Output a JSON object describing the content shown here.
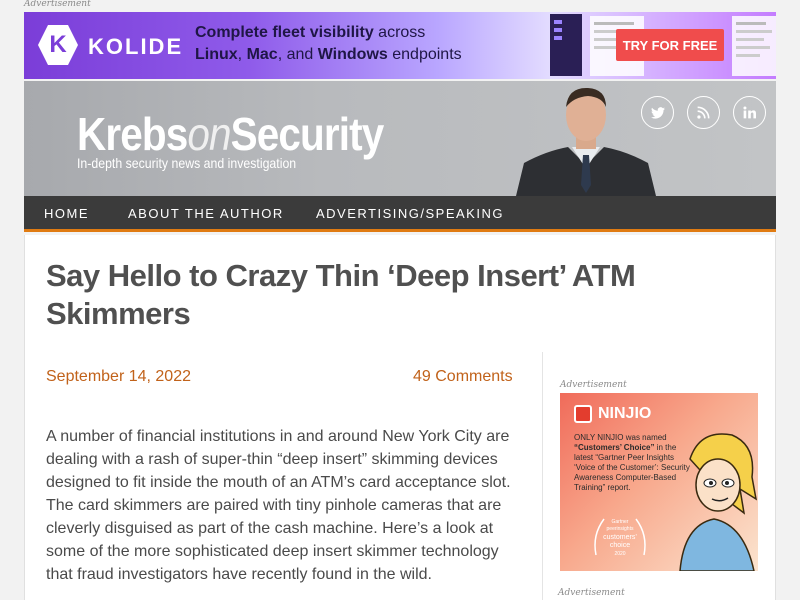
{
  "top_ad": {
    "label": "Advertisement",
    "brand": "KOLIDE",
    "line1_bold": "Complete fleet visibility",
    "line1_rest": " across",
    "line2_linux": "Linux",
    "line2_sep1": ", ",
    "line2_mac": "Mac",
    "line2_sep2": ", and ",
    "line2_windows": "Windows",
    "line2_rest": " endpoints",
    "cta": "TRY FOR FREE",
    "colors": {
      "accent": "#7b3dd8",
      "cta": "#f04c4c"
    }
  },
  "header": {
    "logo_part1": "Krebs",
    "logo_part2": "on",
    "logo_part3": "Security",
    "tagline": "In-depth security news and investigation",
    "social_icons": [
      "twitter-icon",
      "rss-icon",
      "linkedin-icon"
    ]
  },
  "nav": {
    "items": [
      "HOME",
      "ABOUT THE AUTHOR",
      "ADVERTISING/SPEAKING"
    ],
    "accent": "#e07b12"
  },
  "article": {
    "title": "Say Hello to Crazy Thin ‘Deep Insert’ ATM Skimmers",
    "date": "September 14, 2022",
    "comments": "49 Comments",
    "body": "A number of financial institutions in and around New York City are dealing with a rash of super-thin “deep insert” skimming devices designed to fit inside the mouth of an ATM’s card acceptance slot. The card skimmers are paired with tiny pinhole cameras that are cleverly disguised as part of the cash machine. Here’s a look at some of the more sophisticated deep insert skimmer technology that fraud investigators have recently found in the wild.",
    "link_color": "#c1621a"
  },
  "sidebar_ad": {
    "label": "Advertisement",
    "brand": "NINJIO",
    "text_part1": "ONLY NINJIO was named ",
    "text_quote": "“Customers’ Choice”",
    "text_part2": " in the latest “Gartner Peer Insights ‘Voice of the Customer’: Security Awareness Computer-Based Training” report.",
    "badge_line1": "Gartner",
    "badge_line2": "peerinsights",
    "badge_line3": "customers’",
    "badge_line4": "choice",
    "badge_line5": "2020"
  },
  "sidebar_ad2": {
    "label": "Advertisement"
  }
}
